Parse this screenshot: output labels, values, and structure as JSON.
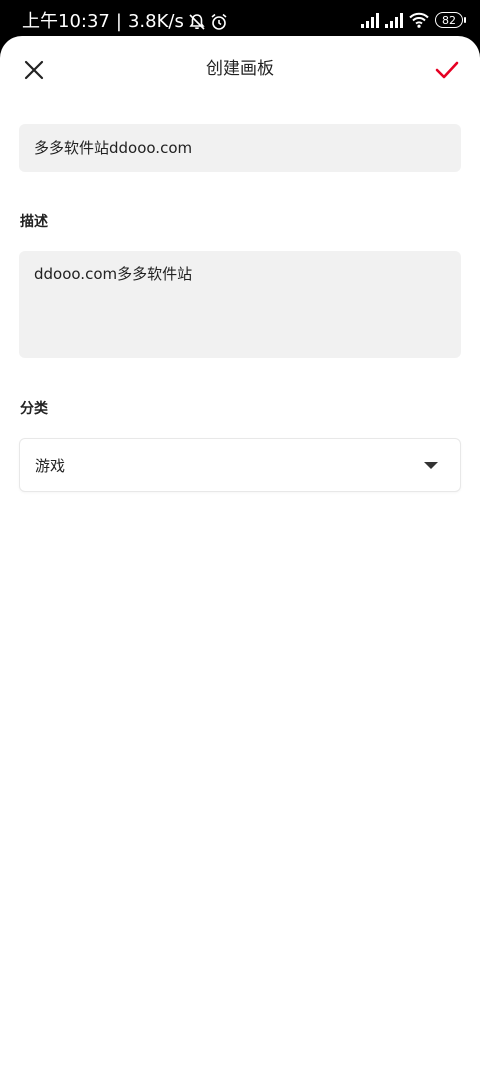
{
  "status_bar": {
    "time": "上午10:37",
    "separator": "|",
    "network_speed": "3.8K/s",
    "battery_level": "82",
    "icons": [
      "mute-bell-icon",
      "alarm-icon",
      "signal-icon",
      "signal-icon",
      "wifi-icon",
      "battery-icon"
    ]
  },
  "header": {
    "title": "创建画板",
    "close_icon": "close-icon",
    "confirm_icon": "check-icon",
    "accent_color": "#e60023"
  },
  "form": {
    "name_value": "多多软件站ddooo.com",
    "description_label": "描述",
    "description_value": "ddooo.com多多软件站",
    "category_label": "分类",
    "category_value": "游戏",
    "category_icon": "dropdown-arrow-icon"
  }
}
